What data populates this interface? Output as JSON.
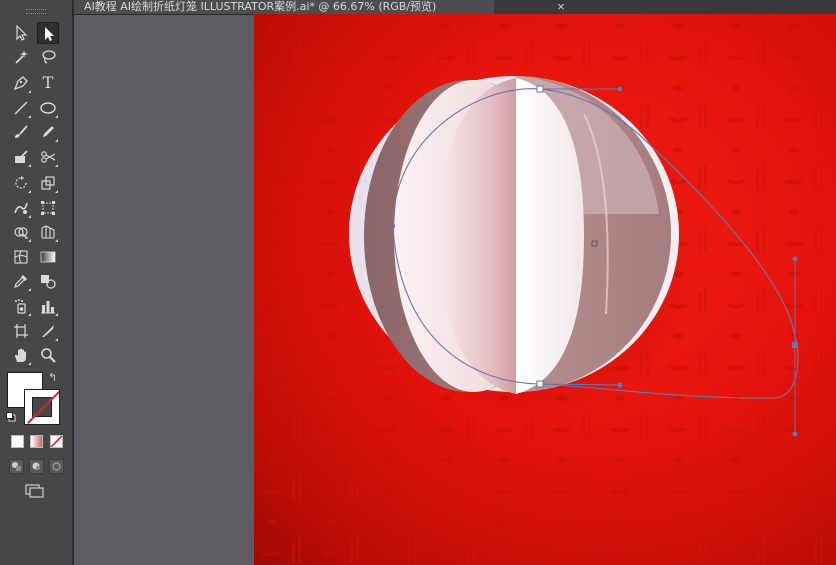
{
  "document": {
    "tab_title": "AI教程  AI绘制折纸灯笼 ILLUSTRATOR案例.ai* @ 66.67% (RGB/预览)",
    "close_glyph": "×"
  },
  "tools": [
    {
      "name": "selection-tool",
      "icon": "arrow-outline"
    },
    {
      "name": "direct-selection-tool",
      "icon": "arrow-filled"
    },
    {
      "name": "magic-wand-tool",
      "icon": "magic-wand"
    },
    {
      "name": "lasso-tool",
      "icon": "lasso"
    },
    {
      "name": "pen-tool",
      "icon": "pen"
    },
    {
      "name": "type-tool",
      "icon": "T"
    },
    {
      "name": "line-segment-tool",
      "icon": "line"
    },
    {
      "name": "ellipse-tool",
      "icon": "ellipse"
    },
    {
      "name": "paintbrush-tool",
      "icon": "brush"
    },
    {
      "name": "pencil-tool",
      "icon": "pencil"
    },
    {
      "name": "blob-brush-tool",
      "icon": "blob-brush"
    },
    {
      "name": "scissors-tool",
      "icon": "scissors"
    },
    {
      "name": "rotate-tool",
      "icon": "rotate"
    },
    {
      "name": "scale-tool",
      "icon": "scale"
    },
    {
      "name": "warp-tool",
      "icon": "warp"
    },
    {
      "name": "free-transform-tool",
      "icon": "free-transform"
    },
    {
      "name": "shape-builder-tool",
      "icon": "shape-builder"
    },
    {
      "name": "perspective-grid-tool",
      "icon": "perspective-grid"
    },
    {
      "name": "mesh-tool",
      "icon": "mesh"
    },
    {
      "name": "gradient-tool",
      "icon": "gradient"
    },
    {
      "name": "eyedropper-tool",
      "icon": "eyedropper"
    },
    {
      "name": "blend-tool",
      "icon": "blend"
    },
    {
      "name": "symbol-sprayer-tool",
      "icon": "symbol-sprayer"
    },
    {
      "name": "column-graph-tool",
      "icon": "column-graph"
    },
    {
      "name": "artboard-tool",
      "icon": "artboard"
    },
    {
      "name": "slice-tool",
      "icon": "slice"
    },
    {
      "name": "hand-tool",
      "icon": "hand"
    },
    {
      "name": "zoom-tool",
      "icon": "zoom"
    }
  ],
  "type_tool_glyph": "T",
  "swap_glyph": "↰",
  "colors": {
    "fill": "#ffffff",
    "stroke": "none",
    "canvas_red": "#e4140c",
    "path_blue": "#6b74a8"
  },
  "active_tool": "direct-selection-tool"
}
